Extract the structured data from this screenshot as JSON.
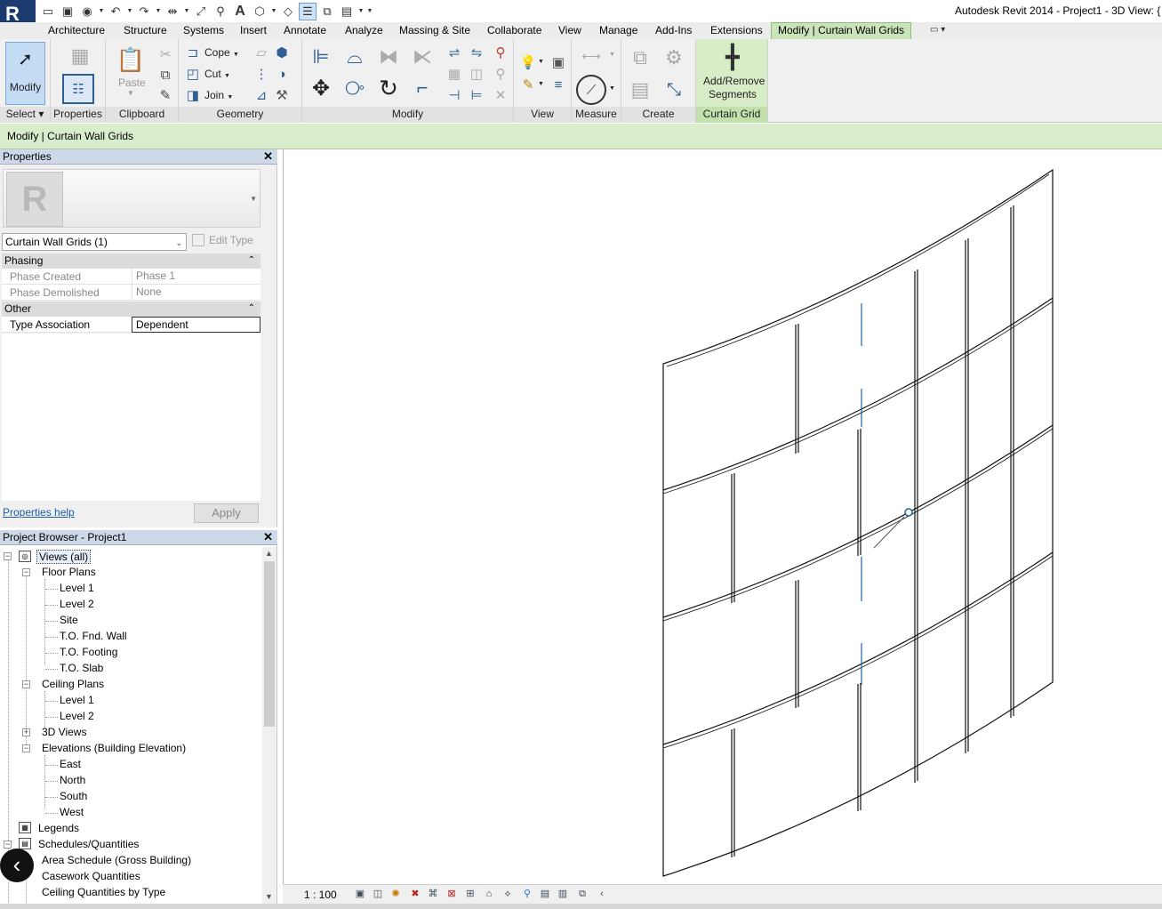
{
  "app": {
    "window_title": "Autodesk Revit 2014 -    Project1 - 3D View: {"
  },
  "ribbon_tabs": [
    {
      "label": "Architecture"
    },
    {
      "label": "Structure"
    },
    {
      "label": "Systems"
    },
    {
      "label": "Insert"
    },
    {
      "label": "Annotate"
    },
    {
      "label": "Analyze"
    },
    {
      "label": "Massing & Site"
    },
    {
      "label": "Collaborate"
    },
    {
      "label": "View"
    },
    {
      "label": "Manage"
    },
    {
      "label": "Add-Ins"
    },
    {
      "label": "Extensions"
    },
    {
      "label": "Modify | Curtain Wall Grids"
    }
  ],
  "ribbon": {
    "modify_label": "Modify",
    "paste_label": "Paste",
    "cope_label": "Cope",
    "cut_label": "Cut",
    "join_label": "Join",
    "add_remove_segments_label": "Add/Remove Segments",
    "panels": {
      "select": "Select",
      "properties": "Properties",
      "clipboard": "Clipboard",
      "geometry": "Geometry",
      "modify": "Modify",
      "view": "View",
      "measure": "Measure",
      "create": "Create",
      "curtain_grid": "Curtain Grid"
    }
  },
  "options_bar": {
    "context": "Modify | Curtain Wall Grids"
  },
  "properties": {
    "title": "Properties",
    "instance_selector": "Curtain Wall Grids (1)",
    "edit_type": "Edit Type",
    "groups": [
      {
        "name": "Phasing",
        "rows": [
          {
            "key": "Phase Created",
            "value": "Phase 1"
          },
          {
            "key": "Phase Demolished",
            "value": "None"
          }
        ]
      },
      {
        "name": "Other",
        "rows": [
          {
            "key": "Type Association",
            "value": "Dependent"
          }
        ]
      }
    ],
    "help_link": "Properties help",
    "apply": "Apply"
  },
  "project_browser": {
    "title": "Project Browser - Project1",
    "items": [
      {
        "label": "Views (all)"
      },
      {
        "label": "Floor Plans"
      },
      {
        "label": "Level 1"
      },
      {
        "label": "Level 2"
      },
      {
        "label": "Site"
      },
      {
        "label": "T.O. Fnd. Wall"
      },
      {
        "label": "T.O. Footing"
      },
      {
        "label": "T.O. Slab"
      },
      {
        "label": "Ceiling Plans"
      },
      {
        "label": "Level 1"
      },
      {
        "label": "Level 2"
      },
      {
        "label": "3D Views"
      },
      {
        "label": "Elevations (Building Elevation)"
      },
      {
        "label": "East"
      },
      {
        "label": "North"
      },
      {
        "label": "South"
      },
      {
        "label": "West"
      },
      {
        "label": "Legends"
      },
      {
        "label": "Schedules/Quantities"
      },
      {
        "label": "Area Schedule (Gross Building)"
      },
      {
        "label": "Casework Quantities"
      },
      {
        "label": "Ceiling Quantities by Type"
      }
    ]
  },
  "view_control_bar": {
    "scale": "1 : 100"
  }
}
